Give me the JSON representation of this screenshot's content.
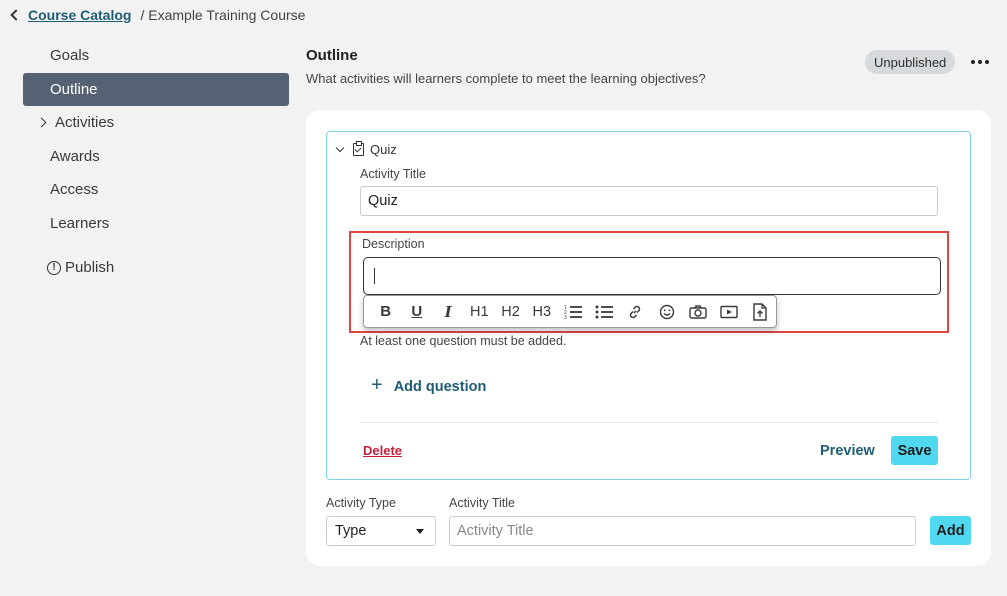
{
  "breadcrumb": {
    "parent": "Course Catalog",
    "current": "/ Example Training Course"
  },
  "sidebar": {
    "items": [
      {
        "label": "Goals"
      },
      {
        "label": "Outline",
        "active": true
      },
      {
        "label": "Activities",
        "expandable": true
      },
      {
        "label": "Awards"
      },
      {
        "label": "Access"
      },
      {
        "label": "Learners"
      },
      {
        "label": "Publish",
        "icon": "alert-circle-icon"
      }
    ]
  },
  "header": {
    "title": "Outline",
    "subtitle": "What activities will learners complete to meet the learning objectives?",
    "status": "Unpublished"
  },
  "activity": {
    "type_label": "Quiz",
    "title_label": "Activity Title",
    "title_value": "Quiz",
    "description_label": "Description",
    "description_value": "",
    "toolbar": [
      "B",
      "U",
      "I",
      "H1",
      "H2",
      "H3",
      "numbered-list",
      "bulleted-list",
      "link",
      "emoji",
      "image",
      "video",
      "file-upload"
    ],
    "hint": "At least one question must be added.",
    "add_question_label": "Add question",
    "delete_label": "Delete",
    "preview_label": "Preview",
    "save_label": "Save"
  },
  "new_activity": {
    "type_label": "Activity Type",
    "type_value": "Type",
    "title_label": "Activity Title",
    "title_placeholder": "Activity Title",
    "add_label": "Add"
  },
  "colors": {
    "accent": "#4fd8f0",
    "link": "#1e5d75",
    "danger": "#c41f3b",
    "nav_active": "#566173",
    "highlight": "#e04545"
  }
}
